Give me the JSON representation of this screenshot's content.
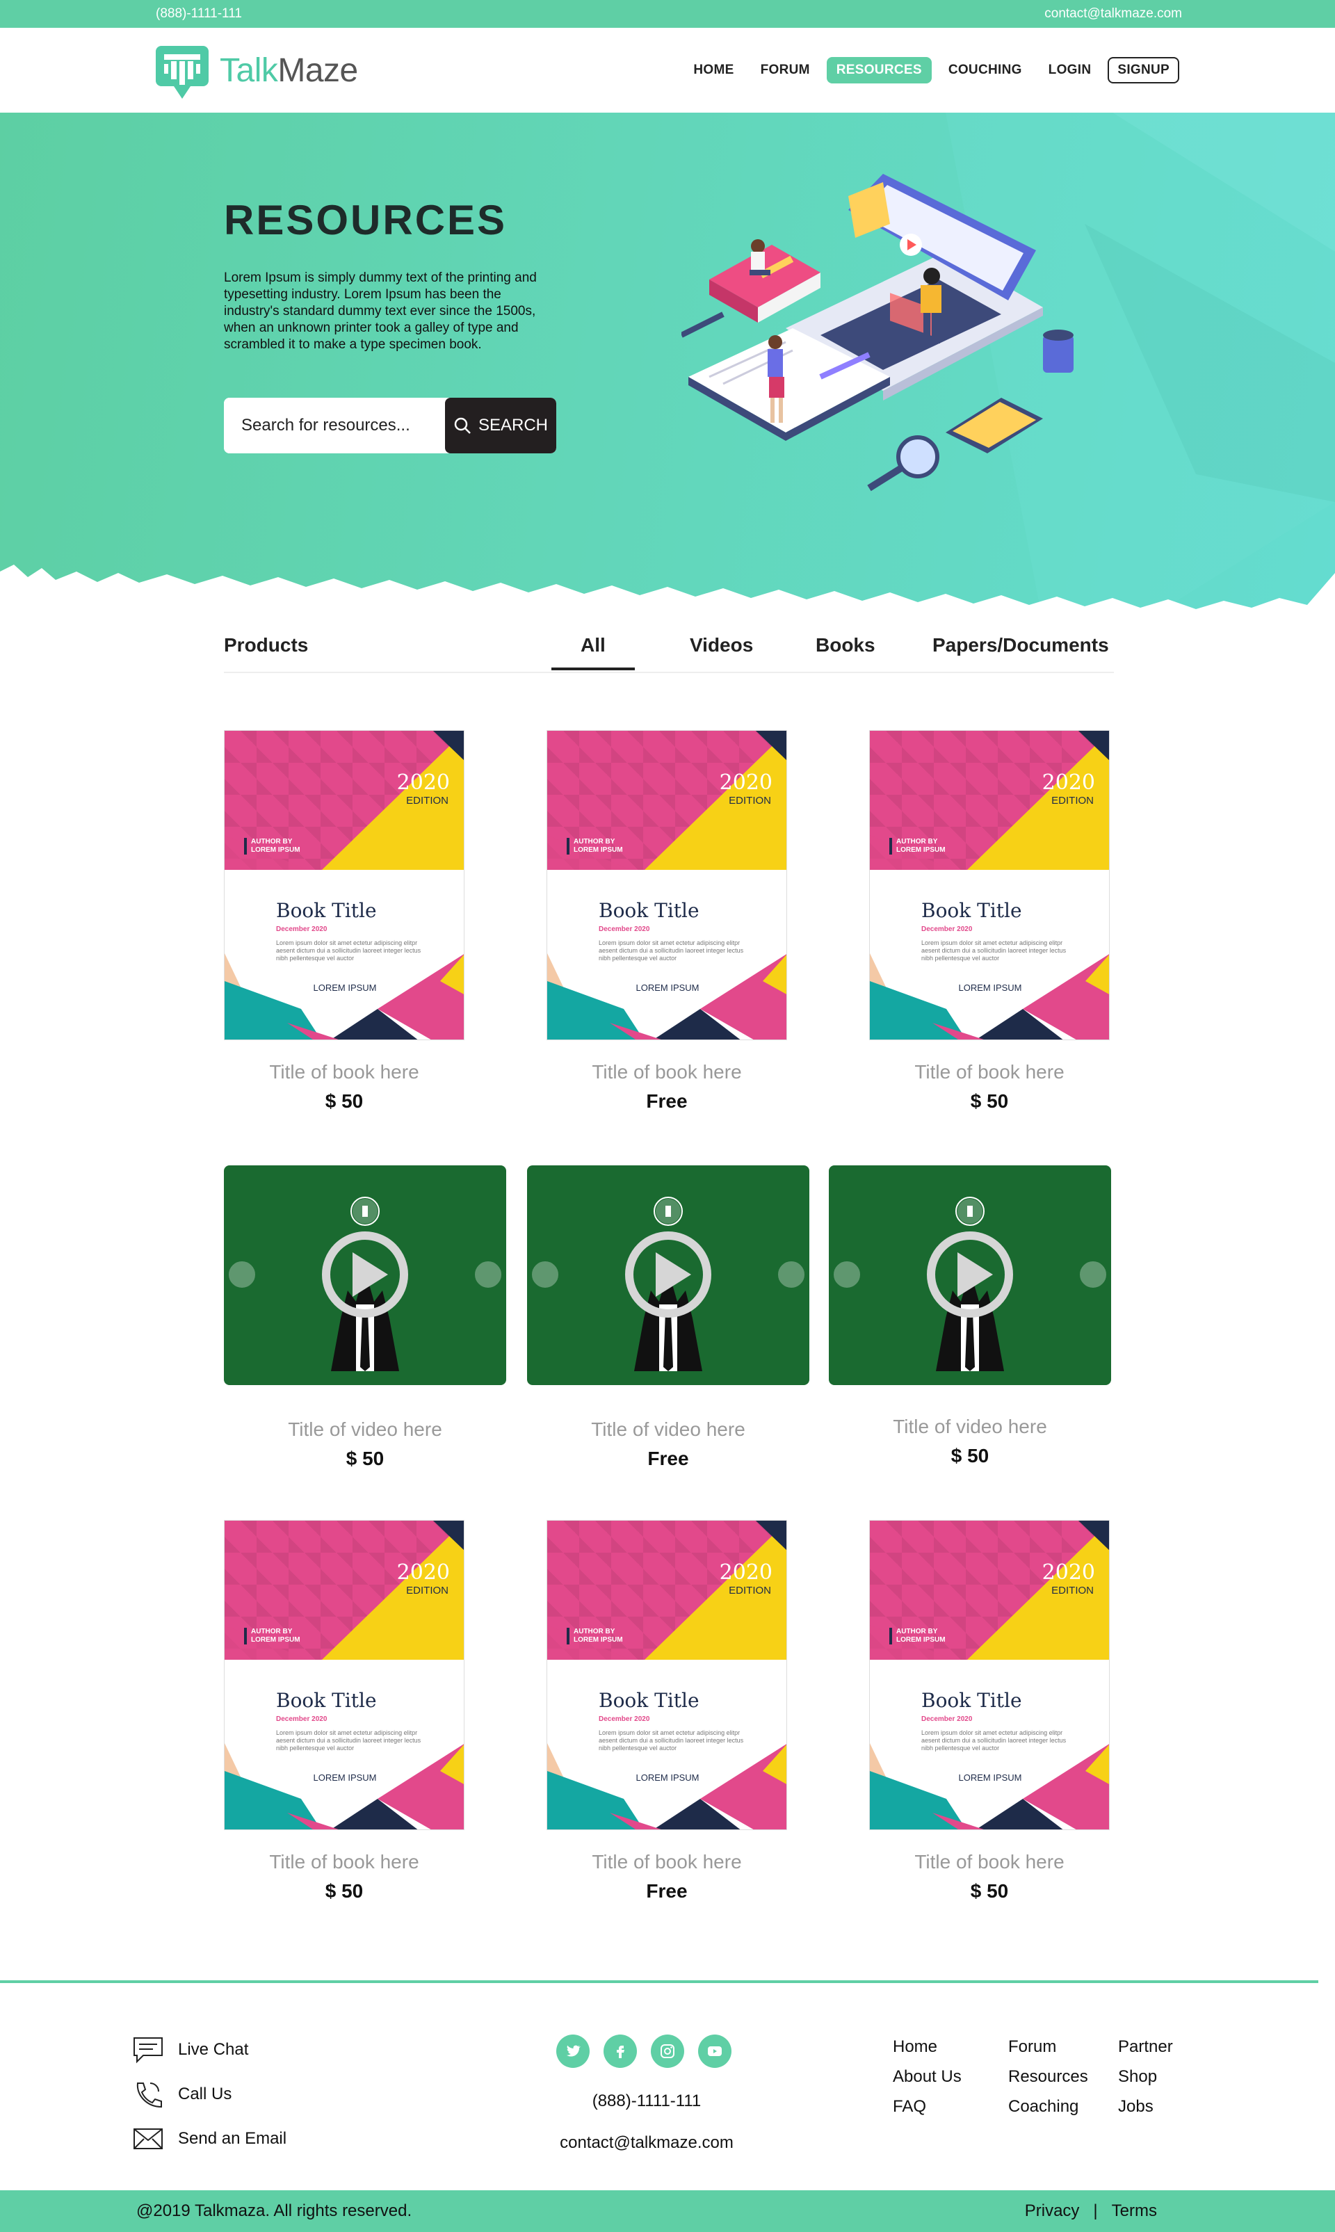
{
  "topbar": {
    "phone": "(888)-1111-111",
    "email": "contact@talkmaze.com"
  },
  "header": {
    "logo_part1": "Talk",
    "logo_part2": "Maze",
    "nav": {
      "home": "HOME",
      "forum": "FORUM",
      "resources": "RESOURCES",
      "couching": "COUCHING",
      "login": "LOGIN",
      "signup": "SIGNUP"
    }
  },
  "hero": {
    "title": "RESOURCES",
    "description": "Lorem Ipsum is simply dummy text of the printing and typesetting industry. Lorem Ipsum has been the industry's standard dummy text ever since the 1500s, when an unknown printer took a galley of type and scrambled it to make a type specimen book.",
    "search_placeholder": "Search for resources...",
    "search_button": "SEARCH"
  },
  "tabs": {
    "products": "Products",
    "all": "All",
    "videos": "Videos",
    "books": "Books",
    "papers": "Papers/Documents"
  },
  "book_cover": {
    "year": "2020",
    "edition": "EDITION",
    "author_by": "AUTHOR BY",
    "author_name": "LOREM IPSUM",
    "title": "Book Title",
    "date": "December 2020",
    "lorem": "Lorem ipsum dolor sit amet ectetur adipiscing elitpr aesent dictum dui a sollicitudin laoreet integer lectus nibh pellentesque vel auctor",
    "footer": "LOREM IPSUM"
  },
  "products": {
    "books_row1": [
      {
        "caption": "Title of book here",
        "price": "$ 50"
      },
      {
        "caption": "Title of book here",
        "price": "Free"
      },
      {
        "caption": "Title of book here",
        "price": "$ 50"
      }
    ],
    "videos": [
      {
        "caption": "Title of video here",
        "price": "$ 50"
      },
      {
        "caption": "Title of video here",
        "price": "Free"
      },
      {
        "caption": "Title of video here",
        "price": "$ 50"
      }
    ],
    "books_row2": [
      {
        "caption": "Title of book here",
        "price": "$ 50"
      },
      {
        "caption": "Title of book here",
        "price": "Free"
      },
      {
        "caption": "Title of book here",
        "price": "$ 50"
      }
    ]
  },
  "footer": {
    "live_chat": "Live Chat",
    "call_us": "Call Us",
    "send_email": "Send an Email",
    "phone": "(888)-1111-111",
    "email": "contact@talkmaze.com",
    "links_col1": [
      "Home",
      "About Us",
      "FAQ"
    ],
    "links_col2": [
      "Forum",
      "Resources",
      "Coaching"
    ],
    "links_col3": [
      "Partner",
      "Shop",
      "Jobs"
    ],
    "copyright": "@2019 Talkmaza. All rights reserved.",
    "privacy": "Privacy",
    "separator": "|",
    "terms": "Terms"
  },
  "colors": {
    "accent": "#5fcfa5",
    "dark": "#231f20",
    "video_bg": "#1a6a30",
    "book_pink": "#e2498b",
    "book_yellow": "#f7d116",
    "book_navy": "#1e2b49"
  },
  "icons": [
    "search-icon",
    "chat-icon",
    "phone-icon",
    "mail-icon",
    "twitter-icon",
    "facebook-icon",
    "instagram-icon",
    "youtube-icon",
    "play-icon"
  ]
}
